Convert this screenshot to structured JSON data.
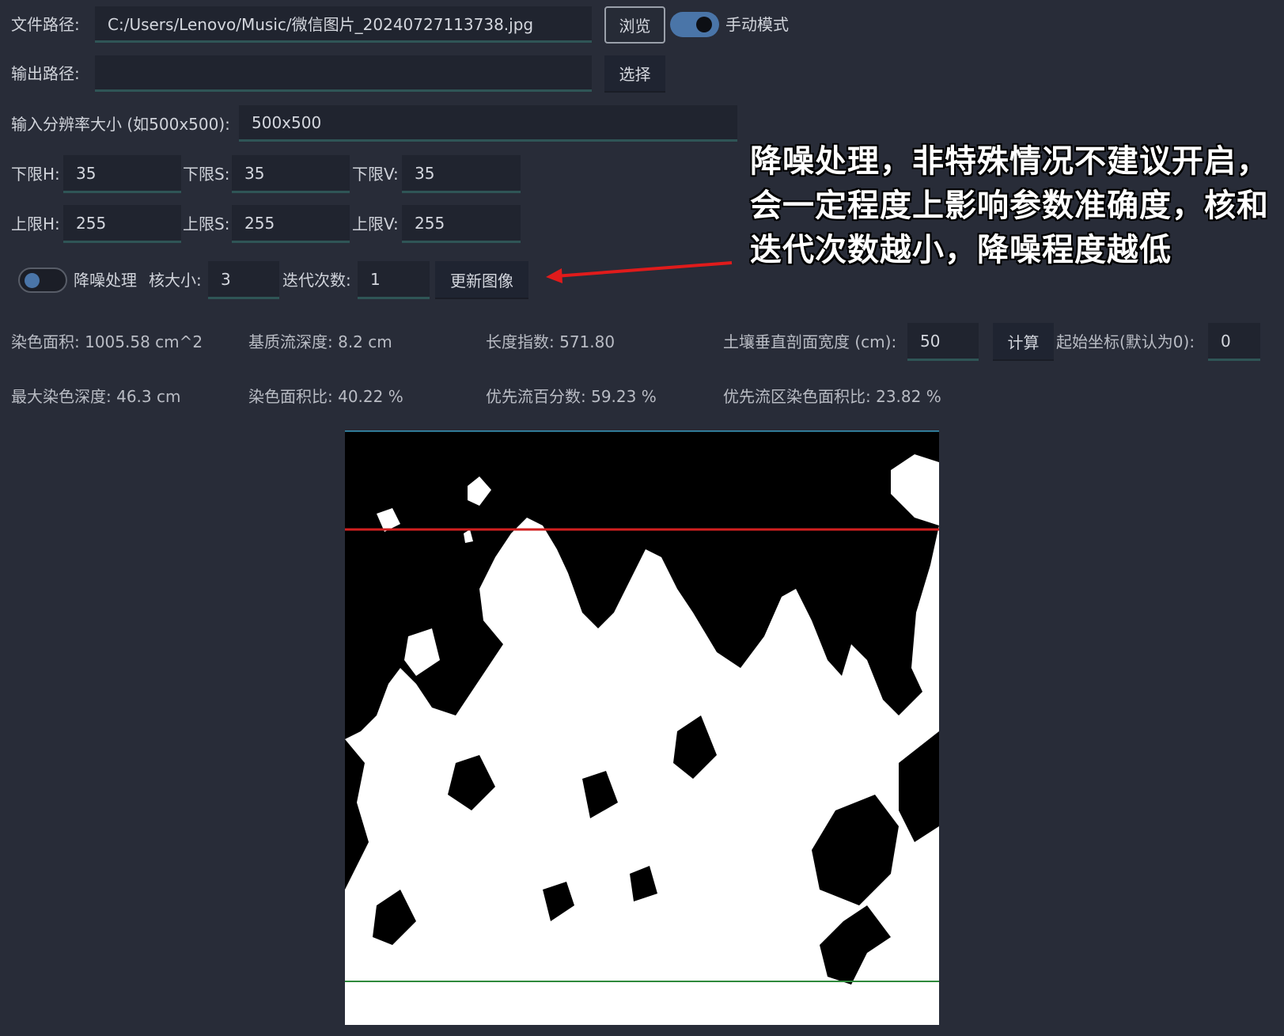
{
  "file": {
    "label": "文件路径:",
    "value": "C:/Users/Lenovo/Music/微信图片_20240727113738.jpg",
    "browse": "浏览"
  },
  "manual_mode": {
    "label": "手动模式",
    "on": true
  },
  "output": {
    "label": "输出路径:",
    "value": "",
    "select": "选择"
  },
  "resolution": {
    "label": "输入分辨率大小 (如500x500):",
    "value": "500x500"
  },
  "lower": [
    {
      "label": "下限H:",
      "value": "35"
    },
    {
      "label": "下限S:",
      "value": "35"
    },
    {
      "label": "下限V:",
      "value": "35"
    }
  ],
  "upper": [
    {
      "label": "上限H:",
      "value": "255"
    },
    {
      "label": "上限S:",
      "value": "255"
    },
    {
      "label": "上限V:",
      "value": "255"
    }
  ],
  "denoise": {
    "label": "降噪处理",
    "on": false,
    "kernel_label": "核大小:",
    "kernel_value": "3",
    "iter_label": "迭代次数:",
    "iter_value": "1",
    "update": "更新图像"
  },
  "annotation": "降噪处理，非特殊情况不建议开启，会一定程度上影响参数准确度，核和迭代次数越小，降噪程度越低",
  "stats": {
    "stain_area": "染色面积: 1005.58 cm^2",
    "matrix_depth": "基质流深度: 8.2 cm",
    "length_index": "长度指数: 571.80",
    "max_depth": "最大染色深度: 46.3 cm",
    "stain_ratio": "染色面积比: 40.22 %",
    "pref_pct": "优先流百分数: 59.23 %",
    "pref_area_ratio": "优先流区染色面积比: 23.82 %"
  },
  "profile": {
    "label": "土壤垂直剖面宽度 (cm):",
    "value": "50",
    "compute": "计算"
  },
  "origin": {
    "label": "起始坐标(默认为0):",
    "value": "0"
  },
  "colors": {
    "accent": "#4a75a8",
    "red_line": "#d21f1f",
    "green_line": "#2f8a3c",
    "top_line": "#3b9cc0"
  }
}
